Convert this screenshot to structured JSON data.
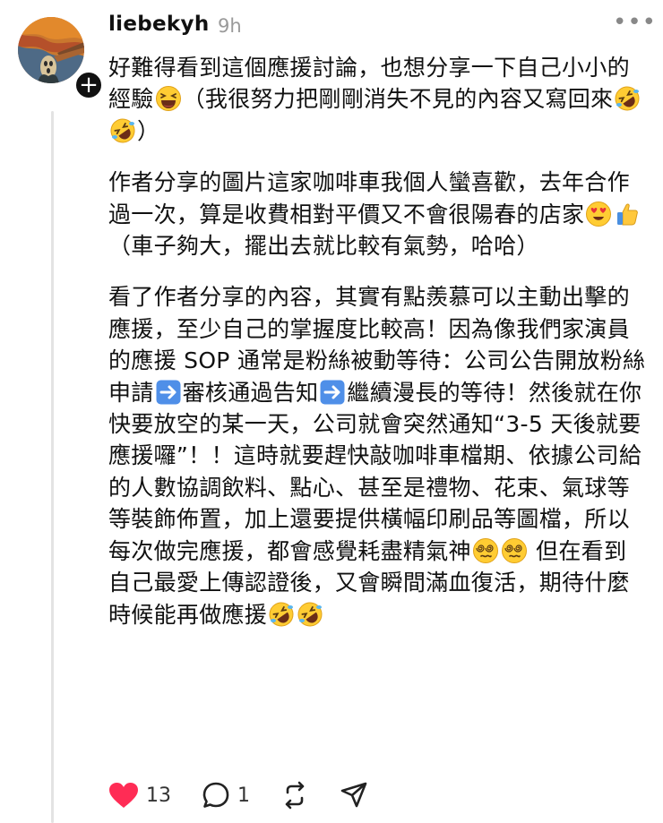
{
  "post": {
    "username": "liebekyh",
    "time": "9h",
    "more_label": "•••",
    "follow_label": "+"
  },
  "paragraphs": [
    [
      {
        "t": "好難得看到這個應援討論，也想分享一下自己小小的經驗"
      },
      {
        "e": "laughing-face"
      },
      {
        "t": "（我很努力把剛剛消失不見的內容又寫回來"
      },
      {
        "e": "rofl-face"
      },
      {
        "e": "rofl-face"
      },
      {
        "t": "）"
      }
    ],
    [
      {
        "t": "作者分享的圖片這家咖啡車我個人蠻喜歡，去年合作過一次，算是收費相對平價又不會很陽春的店家"
      },
      {
        "e": "heart-eyes-face"
      },
      {
        "e": "thumbs-up"
      },
      {
        "t": "（車子夠大，擺出去就比較有氣勢，哈哈）"
      }
    ],
    [
      {
        "t": "看了作者分享的內容，其實有點羨慕可以主動出擊的應援，至少自己的掌握度比較高！因為像我們家演員的應援 SOP 通常是粉絲被動等待：公司公告開放粉絲申請"
      },
      {
        "e": "right-arrow"
      },
      {
        "t": "審核通過告知"
      },
      {
        "e": "right-arrow"
      },
      {
        "t": "繼續漫長的等待！然後就在你快要放空的某一天，公司就會突然通知“3-5 天後就要應援囉”！！這時就要趕快敲咖啡車檔期、依據公司給的人數協調飲料、點心、甚至是禮物、花束、氣球等等裝飾佈置，加上還要提供橫幅印刷品等圖檔，所以每次做完應援，都會感覺耗盡精氣神"
      },
      {
        "e": "dizzy-face"
      },
      {
        "e": "dizzy-face"
      },
      {
        "t": " 但在看到自己最愛上傳認證後，又會瞬間滿血復活，期待什麼時候能再做應援"
      },
      {
        "e": "rofl-face"
      },
      {
        "e": "rofl-face"
      }
    ]
  ],
  "actions": {
    "like_count": "13",
    "reply_count": "1",
    "like_color": "#ff2c55"
  }
}
